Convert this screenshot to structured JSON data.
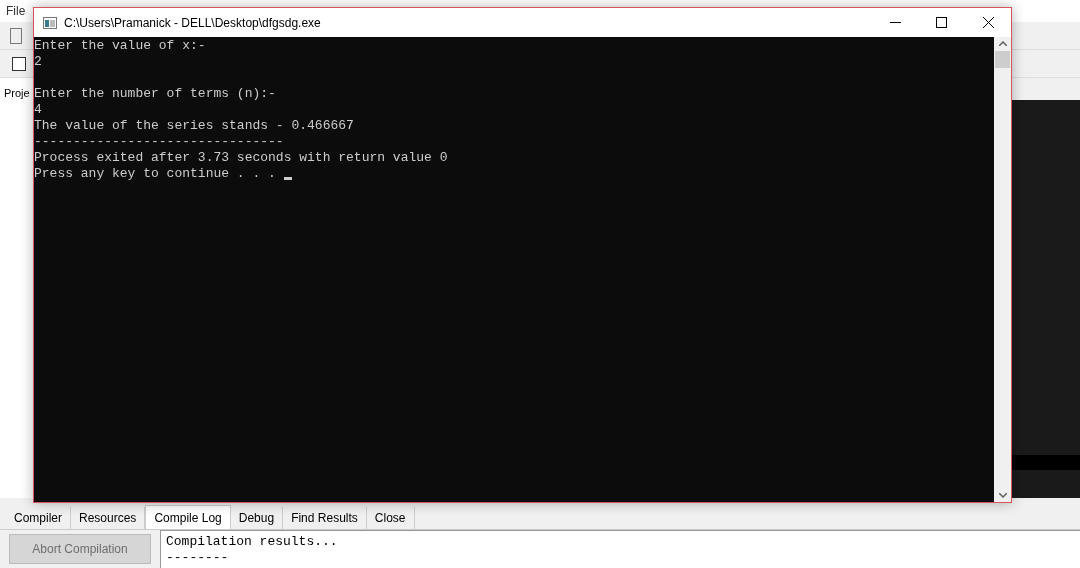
{
  "ide": {
    "menu": [
      "File"
    ],
    "project_panel_label": "Proje",
    "bottom_tabs": [
      {
        "label": "Compiler",
        "selected": false
      },
      {
        "label": "Resources",
        "selected": false
      },
      {
        "label": "Compile Log",
        "selected": true
      },
      {
        "label": "Debug",
        "selected": false
      },
      {
        "label": "Find Results",
        "selected": false
      },
      {
        "label": "Close",
        "selected": false
      }
    ],
    "abort_button": {
      "label": "Abort Compilation",
      "disabled": true
    },
    "log_lines": [
      "Compilation results...",
      "--------"
    ]
  },
  "console": {
    "title": "C:\\Users\\Pramanick - DELL\\Desktop\\dfgsdg.exe",
    "blocks": [
      [
        "Enter the value of x:-",
        "2"
      ],
      [
        "Enter the number of terms (n):-",
        "4",
        "The value of the series stands - 0.466667",
        "--------------------------------",
        "Process exited after 3.73 seconds with return value 0",
        "Press any key to continue . . . "
      ]
    ],
    "cursor": true
  }
}
